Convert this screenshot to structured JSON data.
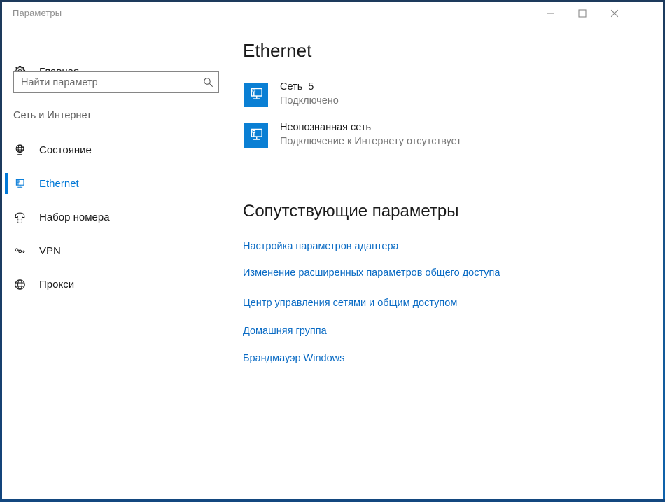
{
  "window": {
    "title": "Параметры",
    "controls": {
      "minimize": "minimize-icon",
      "maximize": "maximize-icon",
      "close": "close-icon"
    }
  },
  "sidebar": {
    "home": {
      "label": "Главная",
      "icon": "gear-icon"
    },
    "search": {
      "placeholder": "Найти параметр",
      "value": "",
      "icon": "search-icon"
    },
    "section_header": "Сеть и Интернет",
    "items": [
      {
        "label": "Состояние",
        "icon": "globe-status-icon",
        "selected": false
      },
      {
        "label": "Ethernet",
        "icon": "ethernet-icon",
        "selected": true
      },
      {
        "label": "Набор номера",
        "icon": "phone-dial-icon",
        "selected": false
      },
      {
        "label": "VPN",
        "icon": "vpn-key-icon",
        "selected": false
      },
      {
        "label": "Прокси",
        "icon": "globe-icon",
        "selected": false
      }
    ]
  },
  "content": {
    "page_title": "Ethernet",
    "networks": [
      {
        "name": "Сеть  5",
        "status": "Подключено",
        "icon": "ethernet-adapter-icon"
      },
      {
        "name": "Неопознанная сеть",
        "status": "Подключение к Интернету отсутствует",
        "icon": "ethernet-adapter-icon"
      }
    ],
    "related": {
      "title": "Сопутствующие параметры",
      "links": [
        "Настройка параметров адаптера",
        "Изменение расширенных параметров общего доступа",
        "Центр управления сетями и общим доступом",
        "Домашняя группа",
        "Брандмауэр Windows"
      ]
    }
  },
  "colors": {
    "accent": "#0078d7",
    "link": "#0a6bc4",
    "icon_tile": "#0a7fd4",
    "frame": "#1d3a5c",
    "muted_text": "#767676"
  }
}
